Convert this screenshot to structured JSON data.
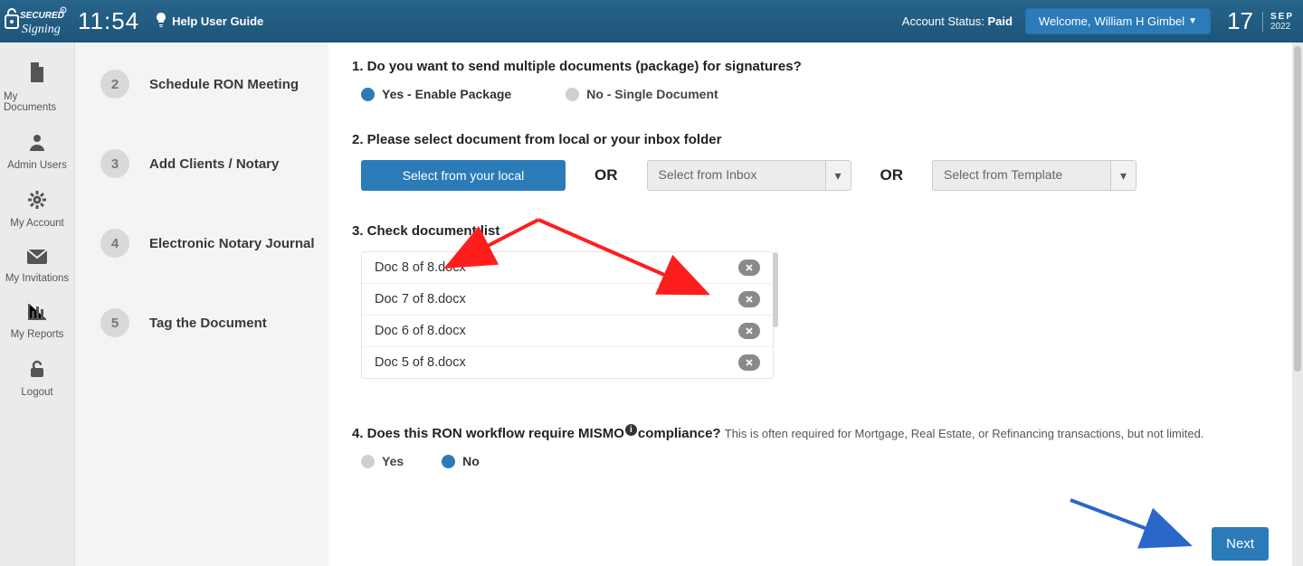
{
  "header": {
    "logo_top": "SECURED",
    "logo_bottom": "Signing",
    "clock": "11:54",
    "help_label": "Help User Guide",
    "account_status_prefix": "Account Status: ",
    "account_status_value": "Paid",
    "welcome_prefix": "Welcome, ",
    "welcome_user": "William H Gimbel",
    "date_day": "17",
    "date_month": "SEP",
    "date_year": "2022"
  },
  "leftnav": {
    "items": [
      {
        "icon": "page-icon",
        "glyph": "📄",
        "label": "My Documents"
      },
      {
        "icon": "user-icon",
        "glyph": "👤",
        "label": "Admin Users"
      },
      {
        "icon": "gear-icon",
        "glyph": "⚙",
        "label": "My Account"
      },
      {
        "icon": "mail-icon",
        "glyph": "✉",
        "label": "My Invitations"
      },
      {
        "icon": "chart-icon",
        "glyph": "📊",
        "label": "My Reports"
      },
      {
        "icon": "unlock-icon",
        "glyph": "🔓",
        "label": "Logout"
      }
    ]
  },
  "steps": [
    {
      "n": "2",
      "label": "Schedule RON Meeting"
    },
    {
      "n": "3",
      "label": "Add Clients / Notary"
    },
    {
      "n": "4",
      "label": "Electronic Notary Journal"
    },
    {
      "n": "5",
      "label": "Tag the Document"
    }
  ],
  "form": {
    "q1": {
      "text": "1. Do you want to send multiple documents (package) for signatures?",
      "opt_yes": "Yes - Enable Package",
      "opt_no": "No - Single Document",
      "selected": "yes"
    },
    "q2": {
      "text": "2. Please select document from local or your inbox folder",
      "local_button": "Select from your local",
      "or": "OR",
      "inbox_placeholder": "Select from Inbox",
      "template_placeholder": "Select from Template"
    },
    "q3": {
      "text": "3. Check document list",
      "docs": [
        "Doc 8 of 8.docx",
        "Doc 7 of 8.docx",
        "Doc 6 of 8.docx",
        "Doc 5 of 8.docx"
      ]
    },
    "q4": {
      "text_a": "4. Does this RON workflow require MISMO",
      "text_b": "compliance?",
      "hint": " This is often required for Mortgage, Real Estate, or Refinancing transactions, but not limited.",
      "opt_yes": "Yes",
      "opt_no": "No",
      "selected": "no"
    },
    "next": "Next"
  }
}
